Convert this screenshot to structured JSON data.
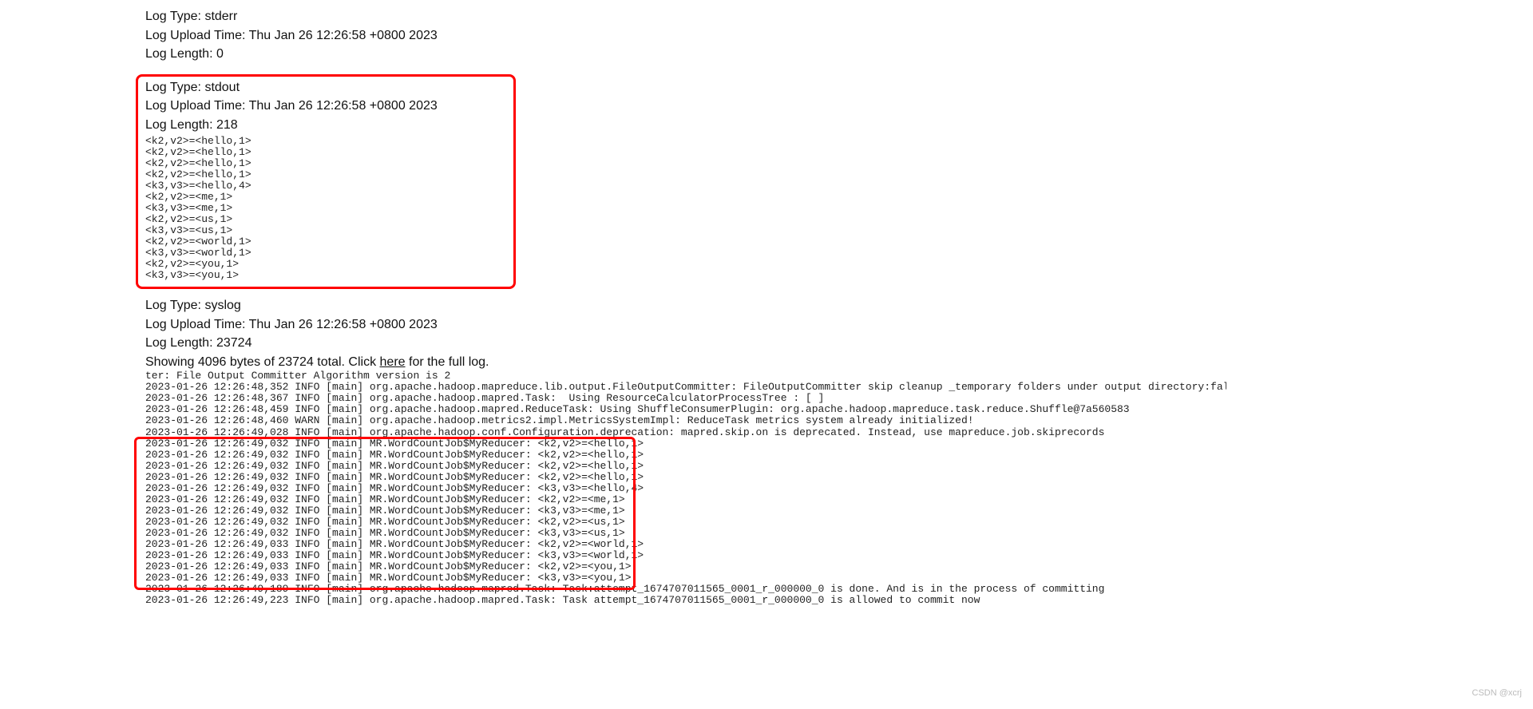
{
  "stderr": {
    "type_label": "Log Type:",
    "type_value": "stderr",
    "upload_label": "Log Upload Time:",
    "upload_value": "Thu Jan 26 12:26:58 +0800 2023",
    "length_label": "Log Length:",
    "length_value": "0"
  },
  "stdout": {
    "type_label": "Log Type:",
    "type_value": "stdout",
    "upload_label": "Log Upload Time:",
    "upload_value": "Thu Jan 26 12:26:58 +0800 2023",
    "length_label": "Log Length:",
    "length_value": "218",
    "lines": [
      "<k2,v2>=<hello,1>",
      "<k2,v2>=<hello,1>",
      "<k2,v2>=<hello,1>",
      "<k2,v2>=<hello,1>",
      "<k3,v3>=<hello,4>",
      "<k2,v2>=<me,1>",
      "<k3,v3>=<me,1>",
      "<k2,v2>=<us,1>",
      "<k3,v3>=<us,1>",
      "<k2,v2>=<world,1>",
      "<k3,v3>=<world,1>",
      "<k2,v2>=<you,1>",
      "<k3,v3>=<you,1>"
    ]
  },
  "syslog": {
    "type_label": "Log Type:",
    "type_value": "syslog",
    "upload_label": "Log Upload Time:",
    "upload_value": "Thu Jan 26 12:26:58 +0800 2023",
    "length_label": "Log Length:",
    "length_value": "23724",
    "showing_prefix": "Showing 4096 bytes of 23724 total. Click ",
    "showing_link": "here",
    "showing_suffix": " for the full log.",
    "lines": [
      "ter: File Output Committer Algorithm version is 2",
      "2023-01-26 12:26:48,352 INFO [main] org.apache.hadoop.mapreduce.lib.output.FileOutputCommitter: FileOutputCommitter skip cleanup _temporary folders under output directory:false, ignore cleanup failures: false",
      "2023-01-26 12:26:48,367 INFO [main] org.apache.hadoop.mapred.Task:  Using ResourceCalculatorProcessTree : [ ]",
      "2023-01-26 12:26:48,459 INFO [main] org.apache.hadoop.mapred.ReduceTask: Using ShuffleConsumerPlugin: org.apache.hadoop.mapreduce.task.reduce.Shuffle@7a560583",
      "2023-01-26 12:26:48,460 WARN [main] org.apache.hadoop.metrics2.impl.MetricsSystemImpl: ReduceTask metrics system already initialized!",
      "2023-01-26 12:26:49,028 INFO [main] org.apache.hadoop.conf.Configuration.deprecation: mapred.skip.on is deprecated. Instead, use mapreduce.job.skiprecords",
      "2023-01-26 12:26:49,032 INFO [main] MR.WordCountJob$MyReducer: <k2,v2>=<hello,1>",
      "2023-01-26 12:26:49,032 INFO [main] MR.WordCountJob$MyReducer: <k2,v2>=<hello,1>",
      "2023-01-26 12:26:49,032 INFO [main] MR.WordCountJob$MyReducer: <k2,v2>=<hello,1>",
      "2023-01-26 12:26:49,032 INFO [main] MR.WordCountJob$MyReducer: <k2,v2>=<hello,1>",
      "2023-01-26 12:26:49,032 INFO [main] MR.WordCountJob$MyReducer: <k3,v3>=<hello,4>",
      "2023-01-26 12:26:49,032 INFO [main] MR.WordCountJob$MyReducer: <k2,v2>=<me,1>",
      "2023-01-26 12:26:49,032 INFO [main] MR.WordCountJob$MyReducer: <k3,v3>=<me,1>",
      "2023-01-26 12:26:49,032 INFO [main] MR.WordCountJob$MyReducer: <k2,v2>=<us,1>",
      "2023-01-26 12:26:49,032 INFO [main] MR.WordCountJob$MyReducer: <k3,v3>=<us,1>",
      "2023-01-26 12:26:49,033 INFO [main] MR.WordCountJob$MyReducer: <k2,v2>=<world,1>",
      "2023-01-26 12:26:49,033 INFO [main] MR.WordCountJob$MyReducer: <k3,v3>=<world,1>",
      "2023-01-26 12:26:49,033 INFO [main] MR.WordCountJob$MyReducer: <k2,v2>=<you,1>",
      "2023-01-26 12:26:49,033 INFO [main] MR.WordCountJob$MyReducer: <k3,v3>=<you,1>",
      "2023-01-26 12:26:49,189 INFO [main] org.apache.hadoop.mapred.Task: Task:attempt_1674707011565_0001_r_000000_0 is done. And is in the process of committing",
      "2023-01-26 12:26:49,223 INFO [main] org.apache.hadoop.mapred.Task: Task attempt_1674707011565_0001_r_000000_0 is allowed to commit now"
    ]
  },
  "watermark": "CSDN @xcrj"
}
